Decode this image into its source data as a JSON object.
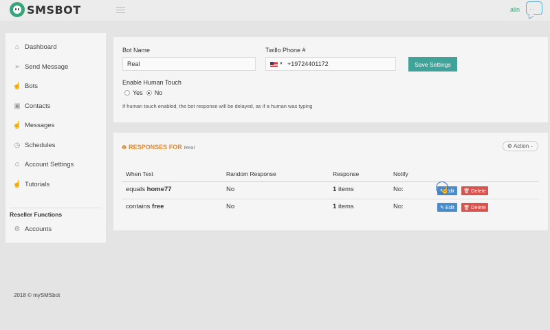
{
  "brand": {
    "name": "SMSBOT"
  },
  "user": {
    "name": "alin"
  },
  "sidebar": {
    "items": [
      {
        "label": "Dashboard",
        "icon": "home-icon"
      },
      {
        "label": "Send Message",
        "icon": "send-icon"
      },
      {
        "label": "Bots",
        "icon": "hand-icon"
      },
      {
        "label": "Contacts",
        "icon": "briefcase-icon"
      },
      {
        "label": "Messages",
        "icon": "hand-icon"
      },
      {
        "label": "Schedules",
        "icon": "clock-icon"
      },
      {
        "label": "Account Settings",
        "icon": "user-icon"
      },
      {
        "label": "Tutorials",
        "icon": "hand-icon"
      }
    ],
    "reseller_title": "Reseller Functions",
    "reseller_items": [
      {
        "label": "Accounts",
        "icon": "gear-icon"
      }
    ]
  },
  "settings": {
    "bot_name_label": "Bot Name",
    "bot_name_value": "Real",
    "phone_label": "Twillo Phone #",
    "phone_value": "+19724401172",
    "save_label": "Save Settings",
    "human_touch_label": "Enable Human Touch",
    "yes_label": "Yes",
    "no_label": "No",
    "selected": "No",
    "hint": "If human touch enabled, the bot response will be delayed, as if a human was typing"
  },
  "responses": {
    "title": "RESPONSES FOR",
    "bot": "Real",
    "action_label": "Action",
    "columns": [
      "When Text",
      "Random Response",
      "Response",
      "Notify"
    ],
    "rows": [
      {
        "when_prefix": "equals",
        "when_keyword": "home77",
        "random": "No",
        "count": "1",
        "count_suffix": "items",
        "notify": "No:",
        "edit": "Edit",
        "delete": "Delete"
      },
      {
        "when_prefix": "contains",
        "when_keyword": "free",
        "random": "No",
        "count": "1",
        "count_suffix": "items",
        "notify": "No:",
        "edit": "Edit",
        "delete": "Delete"
      }
    ]
  },
  "footer": {
    "text": "2018 © mySMSbot"
  },
  "colors": {
    "accent": "#40a39a",
    "brand_green": "#3aa57a",
    "orange": "#e0872a",
    "edit_blue": "#4a8cc9",
    "delete_red": "#d9534f"
  }
}
